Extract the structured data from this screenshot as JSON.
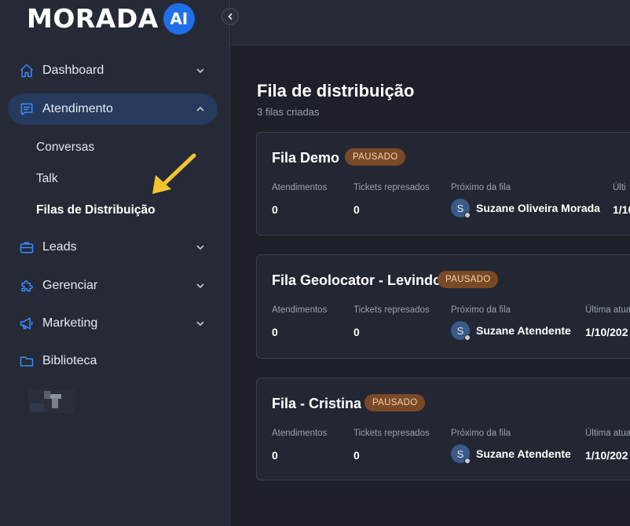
{
  "brand": {
    "name": "MORADA",
    "badge": "AI"
  },
  "colors": {
    "accent": "#1f6fe8",
    "active_bg": "#253a5c",
    "paused_badge": "#7a4a26",
    "arrow": "#f4c430"
  },
  "sidebar": {
    "items": [
      {
        "label": "Dashboard",
        "icon": "home-icon",
        "expanded": false
      },
      {
        "label": "Atendimento",
        "icon": "chat-icon",
        "expanded": true
      },
      {
        "label": "Leads",
        "icon": "briefcase-icon",
        "expanded": false
      },
      {
        "label": "Gerenciar",
        "icon": "puzzle-icon",
        "expanded": false
      },
      {
        "label": "Marketing",
        "icon": "megaphone-icon",
        "expanded": false
      },
      {
        "label": "Biblioteca",
        "icon": "folder-icon",
        "expanded": false
      }
    ],
    "sub_items": [
      {
        "label": "Conversas"
      },
      {
        "label": "Talk"
      },
      {
        "label": "Filas de Distribuição",
        "current": true
      }
    ]
  },
  "main": {
    "title": "Fila de distribuição",
    "subtitle": "3 filas criadas",
    "queues": [
      {
        "name": "Fila Demo",
        "status": "PAUSADO",
        "labels": {
          "atendimentos": "Atendimentos",
          "tickets": "Tickets represados",
          "proximo": "Próximo da fila",
          "ultima": "Últi"
        },
        "atendimentos": "0",
        "tickets": "0",
        "next_initial": "S",
        "next_name": "Suzane Oliveira Morada",
        "last": "1/10"
      },
      {
        "name": "Fila Geolocator - Levindo",
        "status": "PAUSADO",
        "labels": {
          "atendimentos": "Atendimentos",
          "tickets": "Tickets represados",
          "proximo": "Próximo da fila",
          "ultima": "Última atua"
        },
        "atendimentos": "0",
        "tickets": "0",
        "next_initial": "S",
        "next_name": "Suzane Atendente",
        "last": "1/10/202"
      },
      {
        "name": "Fila - Cristina",
        "status": "PAUSADO",
        "labels": {
          "atendimentos": "Atendimentos",
          "tickets": "Tickets represados",
          "proximo": "Próximo da fila",
          "ultima": "Última atua"
        },
        "atendimentos": "0",
        "tickets": "0",
        "next_initial": "S",
        "next_name": "Suzane Atendente",
        "last": "1/10/202"
      }
    ]
  }
}
